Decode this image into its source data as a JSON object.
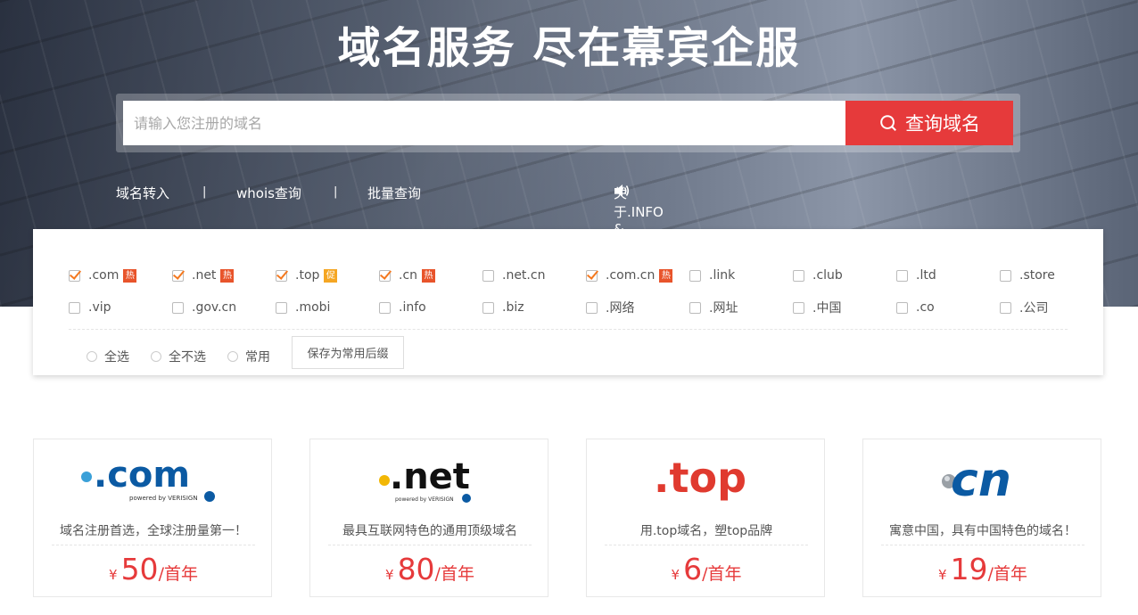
{
  "hero": {
    "title": "域名服务  尽在幕宾企服",
    "search_placeholder": "请输入您注册的域名",
    "search_button": "查询域名"
  },
  "links": {
    "transfer": "域名转入",
    "whois": "whois查询",
    "batch": "批量查询",
    "sep": "|",
    "notice": "关于.INFO & .MOBI实名认证的重要通知"
  },
  "tlds": [
    {
      "label": ".com",
      "checked": true,
      "badge": "热",
      "badge_type": "hot"
    },
    {
      "label": ".net",
      "checked": true,
      "badge": "热",
      "badge_type": "hot"
    },
    {
      "label": ".top",
      "checked": true,
      "badge": "促",
      "badge_type": "promo"
    },
    {
      "label": ".cn",
      "checked": true,
      "badge": "热",
      "badge_type": "hot"
    },
    {
      "label": ".net.cn",
      "checked": false
    },
    {
      "label": ".com.cn",
      "checked": true,
      "badge": "热",
      "badge_type": "hot"
    },
    {
      "label": ".link",
      "checked": false
    },
    {
      "label": ".club",
      "checked": false
    },
    {
      "label": ".ltd",
      "checked": false
    },
    {
      "label": ".store",
      "checked": false
    },
    {
      "label": ".vip",
      "checked": false
    },
    {
      "label": ".gov.cn",
      "checked": false
    },
    {
      "label": ".mobi",
      "checked": false
    },
    {
      "label": ".info",
      "checked": false
    },
    {
      "label": ".biz",
      "checked": false
    },
    {
      "label": ".网络",
      "checked": false
    },
    {
      "label": ".网址",
      "checked": false
    },
    {
      "label": ".中国",
      "checked": false
    },
    {
      "label": ".co",
      "checked": false
    },
    {
      "label": ".公司",
      "checked": false
    }
  ],
  "options": {
    "select_all": "全选",
    "select_none": "全不选",
    "common": "常用",
    "save_common": "保存为常用后缀"
  },
  "cards": [
    {
      "logo_text": ".com",
      "logo_sub": "powered by VERISIGN",
      "desc": "域名注册首选，全球注册量第一！",
      "currency": "¥",
      "price": "50",
      "unit": "/首年"
    },
    {
      "logo_text": ".net",
      "logo_sub": "powered by VERISIGN",
      "desc": "最具互联网特色的通用顶级域名",
      "currency": "¥",
      "price": "80",
      "unit": "/首年"
    },
    {
      "logo_text": ".top",
      "desc": "用.top域名，塑top品牌",
      "currency": "¥",
      "price": "6",
      "unit": "/首年"
    },
    {
      "logo_text": "cn",
      "desc": "寓意中国，具有中国特色的域名！",
      "currency": "¥",
      "price": "19",
      "unit": "/首年"
    }
  ],
  "colors": {
    "accent": "#e63a3b",
    "check": "#f47920",
    "hot_badge": "#e8542b",
    "promo_badge": "#f5a623"
  }
}
